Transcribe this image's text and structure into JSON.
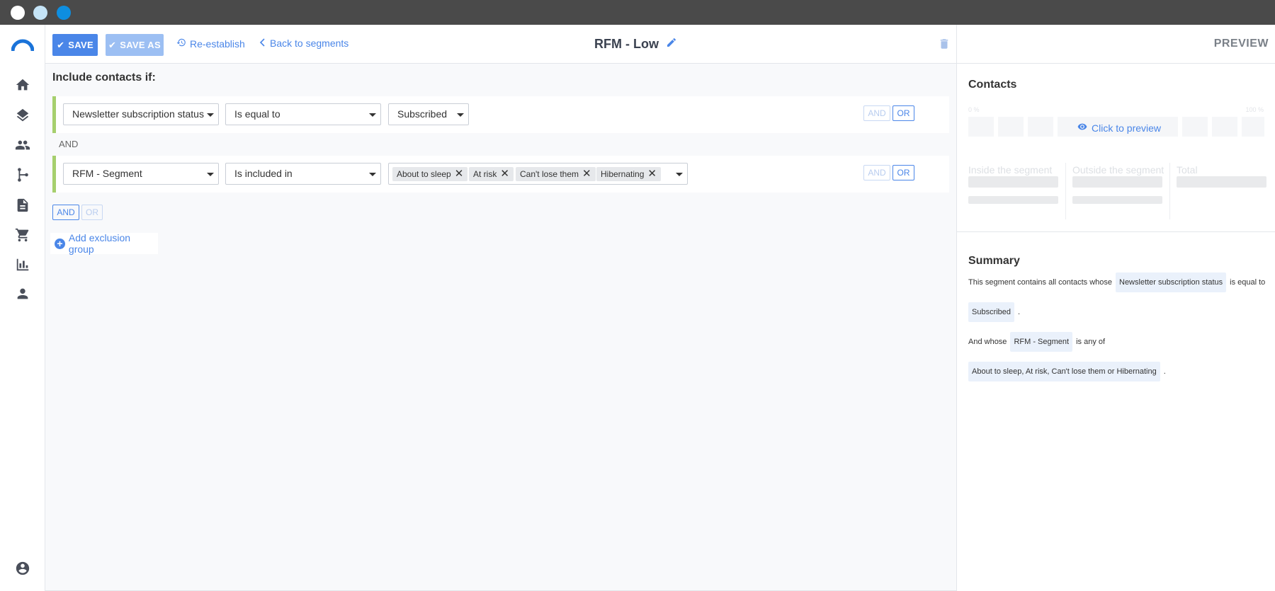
{
  "window": {
    "buttons": [
      "close",
      "minimize",
      "maximize"
    ]
  },
  "nav": {
    "logo": "brand-logo",
    "items": [
      {
        "name": "home-icon"
      },
      {
        "name": "layers-icon"
      },
      {
        "name": "contacts-icon"
      },
      {
        "name": "workflow-icon"
      },
      {
        "name": "document-icon"
      },
      {
        "name": "cart-icon"
      },
      {
        "name": "analytics-icon"
      },
      {
        "name": "person-icon"
      }
    ],
    "account_icon": "account-circle-icon"
  },
  "toolbar": {
    "save_label": "SAVE",
    "save_as_label": "SAVE AS",
    "reestablish_label": "Re-establish",
    "back_label": "Back to segments"
  },
  "segment": {
    "title": "RFM - Low"
  },
  "rules": {
    "include_title": "Include contacts if:",
    "conditions": [
      {
        "field": "Newsletter subscription status",
        "operator": "Is equal to",
        "value": "Subscribed",
        "and_label": "AND",
        "or_label": "OR"
      },
      {
        "field": "RFM - Segment",
        "operator": "Is included in",
        "chips": [
          "About to sleep",
          "At risk",
          "Can't lose them",
          "Hibernating"
        ],
        "and_label": "AND",
        "or_label": "OR"
      }
    ],
    "separator": "AND",
    "group_and_label": "AND",
    "group_or_label": "OR",
    "add_exclusion_label": "Add exclusion group"
  },
  "preview": {
    "header": "PREVIEW",
    "contacts_title": "Contacts",
    "pct_min": "0 %",
    "pct_max": "100 %",
    "click_to_preview": "Click to preview",
    "inside_label": "Inside the segment",
    "outside_label": "Outside the segment",
    "total_label": "Total"
  },
  "summary": {
    "title": "Summary",
    "line1_prefix": "This segment contains all contacts whose",
    "line1_field": "Newsletter subscription status",
    "line1_op": "is equal to",
    "line2_value": "Subscribed",
    "line2_suffix": ".",
    "line3_prefix": "And whose",
    "line3_field": "RFM - Segment",
    "line3_op": "is any of",
    "line4_value": "About to sleep, At risk, Can't lose them or Hibernating",
    "line4_suffix": "."
  },
  "colors": {
    "accent": "#4a86e8",
    "accent_disabled": "#9cbff3",
    "condition_bar": "#a6cf6d"
  }
}
